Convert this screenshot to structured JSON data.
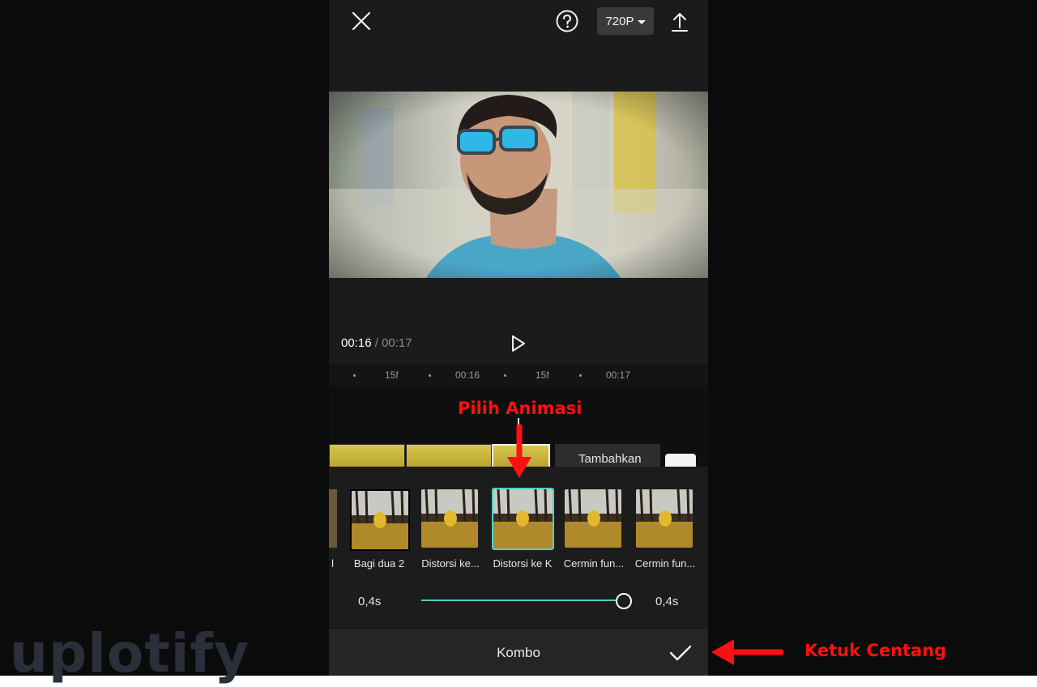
{
  "topbar": {
    "close_icon": "close-icon",
    "help_icon": "help-icon",
    "resolution_label": "720P",
    "export_icon": "export-icon"
  },
  "player": {
    "current_time": "00:16",
    "separator": " / ",
    "total_time": "00:17",
    "play_icon": "play-icon"
  },
  "ruler": {
    "marks": [
      "15f",
      "00:16",
      "15f",
      "00:17"
    ]
  },
  "timeline": {
    "add_clip_label": "Tambahkan"
  },
  "animations": {
    "items": [
      {
        "label": "Bagi dua 2",
        "selected": false
      },
      {
        "label": "Distorsi ke...",
        "selected": false
      },
      {
        "label": "Distorsi ke K",
        "selected": true
      },
      {
        "label": "Cermin fun...",
        "selected": false
      },
      {
        "label": "Cermin fun...",
        "selected": false
      }
    ],
    "partial_label": "l"
  },
  "duration": {
    "min_label": "0,4s",
    "max_label": "0,4s",
    "value_fraction": 1.0
  },
  "bottombar": {
    "category_label": "Kombo",
    "confirm_icon": "checkmark-icon"
  },
  "annotations": {
    "top": "Pilih Animasi",
    "right": "Ketuk Centang"
  },
  "watermark": "uplotify",
  "colors": {
    "accent": "#4fd1c5",
    "annotation": "#ff1010",
    "phone_bg": "#1b1b1b"
  }
}
